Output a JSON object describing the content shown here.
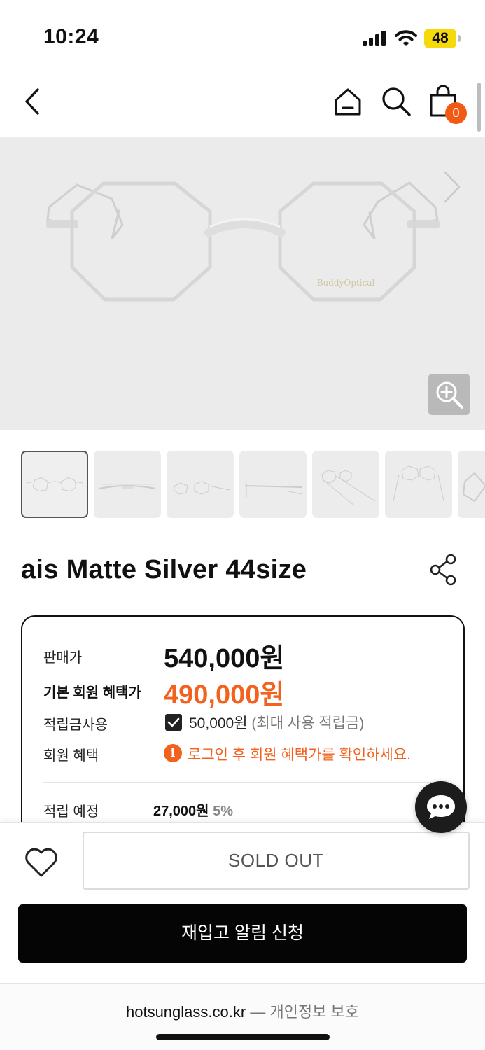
{
  "status_bar": {
    "time": "10:24",
    "battery": "48"
  },
  "nav": {
    "cart_count": "0"
  },
  "hero": {
    "brand_engraving": "BuddyOptical"
  },
  "product": {
    "title": "ais Matte Silver 44size"
  },
  "price_box": {
    "sale_label": "판매가",
    "sale_price": "540,000원",
    "member_label": "기본 회원 혜택가",
    "member_price": "490,000원",
    "points_label": "적립금사용",
    "points_value": "50,000원",
    "points_note": "(최대 사용 적립금)",
    "benefit_label": "회원 혜택",
    "benefit_icon": "i",
    "benefit_message": "로그인 후 회원 혜택가를 확인하세요.",
    "earn_label": "적립 예정",
    "earn_amount": "27,000원",
    "earn_rate": "5%"
  },
  "actions": {
    "soldout": "SOLD OUT",
    "restock": "재입고 알림 신청"
  },
  "browser": {
    "domain": "hotsunglass.co.kr",
    "separator": "—",
    "note": "개인정보 보호"
  },
  "colors": {
    "accent": "#f2611d",
    "badge": "#f25a14",
    "battery": "#f5d90a"
  }
}
